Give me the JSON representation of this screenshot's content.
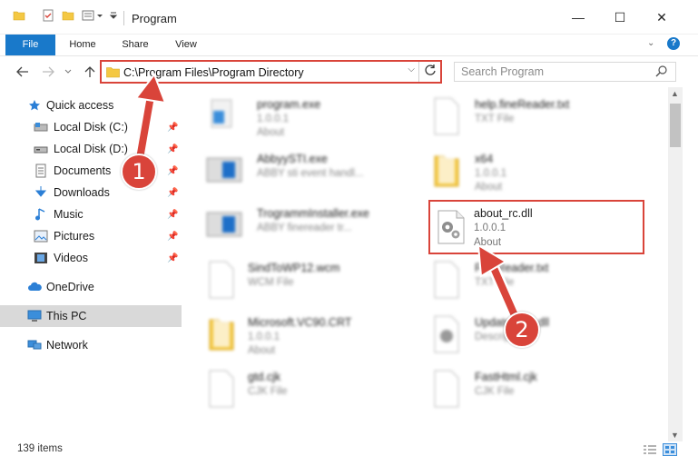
{
  "window": {
    "title": "Program",
    "minimize": "—",
    "maximize": "☐",
    "close": "✕"
  },
  "ribbon": {
    "tabs": [
      "File",
      "Home",
      "Share",
      "View"
    ]
  },
  "address_bar": {
    "path": "C:\\Program Files\\Program Directory",
    "search_placeholder": "Search Program"
  },
  "sidebar": {
    "items": [
      {
        "label": "Quick access",
        "icon": "star-icon"
      },
      {
        "label": "Local Disk (C:)",
        "icon": "drive-icon",
        "pinned": true
      },
      {
        "label": "Local Disk (D:)",
        "icon": "drive-icon",
        "pinned": true
      },
      {
        "label": "Documents",
        "icon": "documents-icon",
        "pinned": true
      },
      {
        "label": "Downloads",
        "icon": "download-icon",
        "pinned": true
      },
      {
        "label": "Music",
        "icon": "music-icon",
        "pinned": true
      },
      {
        "label": "Pictures",
        "icon": "pictures-icon",
        "pinned": true
      },
      {
        "label": "Videos",
        "icon": "videos-icon",
        "pinned": true
      },
      {
        "label": "OneDrive",
        "icon": "cloud-icon"
      },
      {
        "label": "This PC",
        "icon": "computer-icon",
        "selected": true
      },
      {
        "label": "Network",
        "icon": "network-icon"
      }
    ]
  },
  "files_left": [
    {
      "name": "program.exe",
      "line2": "1.0.0.1",
      "line3": "About"
    },
    {
      "name": "AbbyySTI.exe",
      "line2": "ABBY sti event handl...",
      "line3": ""
    },
    {
      "name": "TrogrammInstaller.exe",
      "line2": "ABBY finereader tr...",
      "line3": ""
    },
    {
      "name": "SindToWP12.wcm",
      "line2": "WCM File",
      "line3": ""
    },
    {
      "name": "Microsoft.VC90.CRT",
      "line2": "1.0.0.1",
      "line3": "About"
    },
    {
      "name": "gtd.cjk",
      "line2": "CJK File",
      "line3": ""
    }
  ],
  "files_right": [
    {
      "name": "help.fineReader.txt",
      "line2": "TXT File",
      "line3": ""
    },
    {
      "name": "x64",
      "line2": "1.0.0.1",
      "line3": "About"
    },
    {
      "name": "FineReader.txt",
      "line2": "TXT File",
      "line3": ""
    },
    {
      "name": "UpdateSt19.dll",
      "line2": "Description",
      "line3": ""
    },
    {
      "name": "FastHtml.cjk",
      "line2": "CJK File",
      "line3": ""
    }
  ],
  "highlighted_file": {
    "name": "about_rc.dll",
    "version": "1.0.0.1",
    "description": "About"
  },
  "status": {
    "item_count": "139 items"
  },
  "annotations": {
    "badge1": "1",
    "badge2": "2",
    "color": "#d9443a"
  }
}
